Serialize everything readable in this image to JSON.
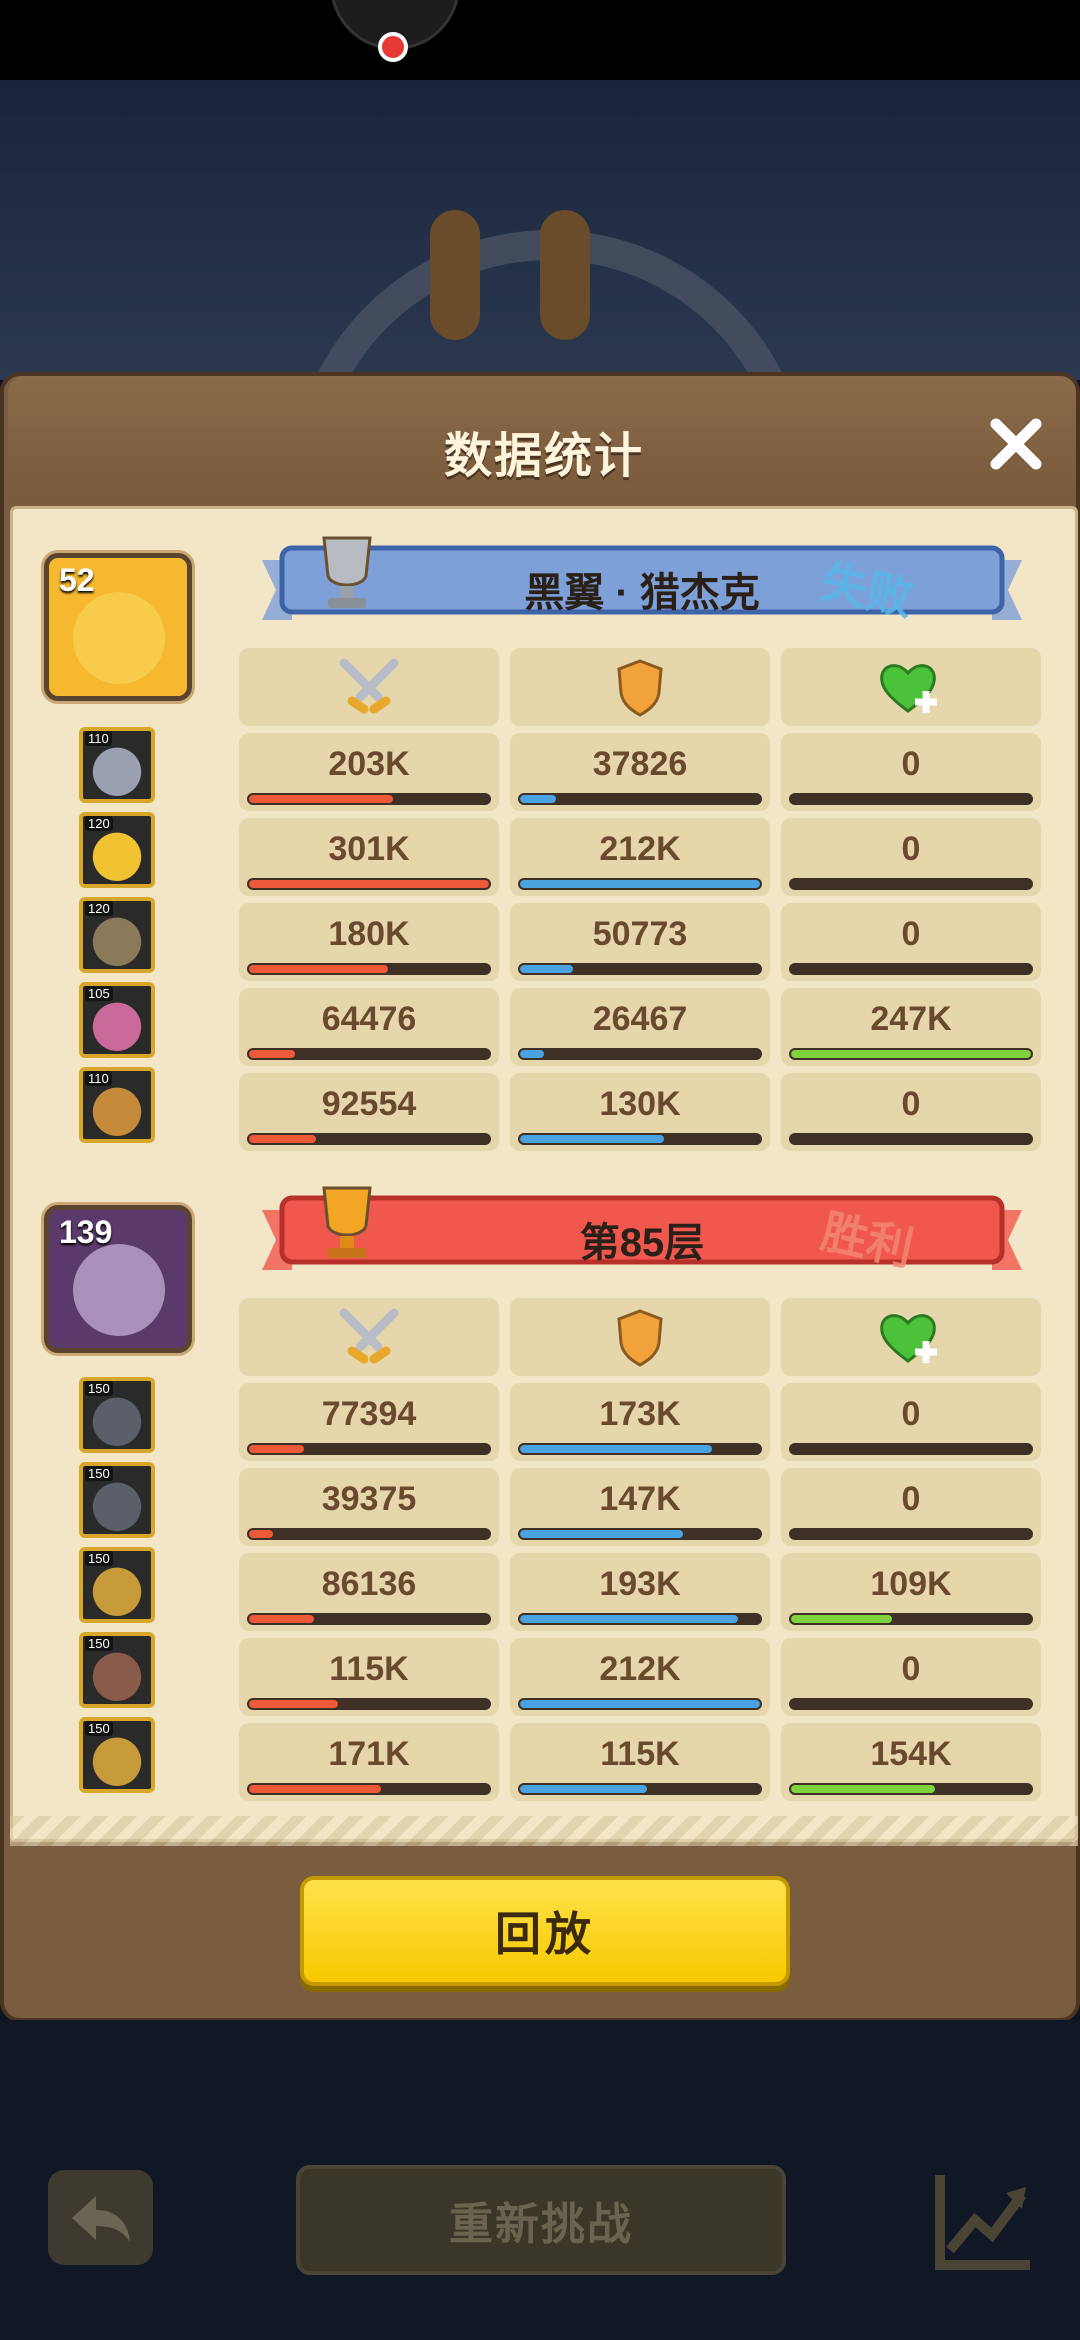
{
  "panel": {
    "title": "数据统计",
    "close_icon": "close-icon",
    "replay_label": "回放"
  },
  "teams": [
    {
      "leader_level": "52",
      "name": "黑翼 · 猎杰克",
      "result": "失败",
      "result_color": "#55b8e8",
      "banner_color": "#7ea0d8",
      "heroes": [
        {
          "level": "110",
          "damage": "203K",
          "defense": "37826",
          "heal": "0",
          "damage_pct": 0.6,
          "defense_pct": 0.15,
          "heal_pct": 0
        },
        {
          "level": "120",
          "damage": "301K",
          "defense": "212K",
          "heal": "0",
          "damage_pct": 1.0,
          "defense_pct": 1.0,
          "heal_pct": 0
        },
        {
          "level": "120",
          "damage": "180K",
          "defense": "50773",
          "heal": "0",
          "damage_pct": 0.58,
          "defense_pct": 0.22,
          "heal_pct": 0
        },
        {
          "level": "105",
          "damage": "64476",
          "defense": "26467",
          "heal": "247K",
          "damage_pct": 0.19,
          "defense_pct": 0.1,
          "heal_pct": 1.0
        },
        {
          "level": "110",
          "damage": "92554",
          "defense": "130K",
          "heal": "0",
          "damage_pct": 0.28,
          "defense_pct": 0.6,
          "heal_pct": 0
        }
      ]
    },
    {
      "leader_level": "139",
      "name": "第85层",
      "result": "胜利",
      "result_color": "#f08870",
      "banner_color": "#f0584e",
      "heroes": [
        {
          "level": "150",
          "damage": "77394",
          "defense": "173K",
          "heal": "0",
          "damage_pct": 0.23,
          "defense_pct": 0.8,
          "heal_pct": 0
        },
        {
          "level": "150",
          "damage": "39375",
          "defense": "147K",
          "heal": "0",
          "damage_pct": 0.1,
          "defense_pct": 0.68,
          "heal_pct": 0
        },
        {
          "level": "150",
          "damage": "86136",
          "defense": "193K",
          "heal": "109K",
          "damage_pct": 0.27,
          "defense_pct": 0.91,
          "heal_pct": 0.42
        },
        {
          "level": "150",
          "damage": "115K",
          "defense": "212K",
          "heal": "0",
          "damage_pct": 0.37,
          "defense_pct": 1.0,
          "heal_pct": 0
        },
        {
          "level": "150",
          "damage": "171K",
          "defense": "115K",
          "heal": "154K",
          "damage_pct": 0.55,
          "defense_pct": 0.53,
          "heal_pct": 0.6
        }
      ]
    }
  ],
  "column_icons": [
    "crossed-swords-icon",
    "shield-icon",
    "heart-plus-icon"
  ],
  "bottom": {
    "retry_label": "重新挑战",
    "back_icon": "back-arrow-icon",
    "trend_icon": "trend-chart-icon"
  },
  "colors": {
    "damage": "#ec5a3a",
    "defense": "#4aa3e0",
    "heal": "#7ed33e",
    "replay_button": "#f8c900"
  }
}
